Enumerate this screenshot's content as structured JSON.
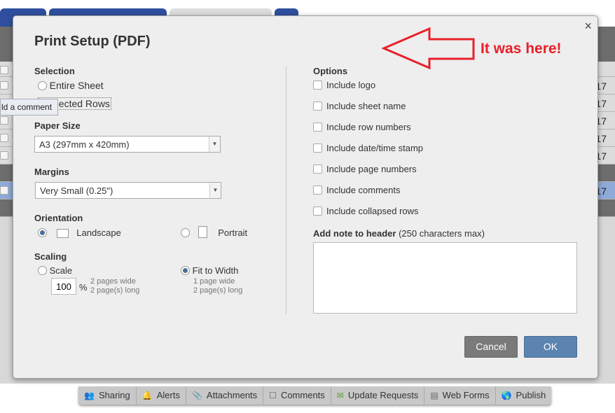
{
  "background": {
    "row_values": [
      "17",
      "17",
      "17",
      "17",
      "17",
      "17"
    ]
  },
  "tooltip": "ld a comment",
  "dialog": {
    "title": "Print Setup (PDF)",
    "close_icon": "×",
    "selection": {
      "label": "Selection",
      "entire_sheet": "Entire Sheet",
      "selected_rows": "elected Rows"
    },
    "paper_size": {
      "label": "Paper Size",
      "value": "A3 (297mm x 420mm)"
    },
    "margins": {
      "label": "Margins",
      "value": "Very Small (0.25\")"
    },
    "orientation": {
      "label": "Orientation",
      "landscape": "Landscape",
      "portrait": "Portrait",
      "selected": "Landscape"
    },
    "scaling": {
      "label": "Scaling",
      "scale": "Scale",
      "scale_value": "100",
      "percent": "%",
      "scale_info1": "2 pages wide",
      "scale_info2": "2 page(s) long",
      "fit": "Fit to Width",
      "fit_info1": "1 page wide",
      "fit_info2": "2 page(s) long",
      "selected": "Fit to Width"
    },
    "options": {
      "label": "Options",
      "items": [
        "Include logo",
        "Include sheet name",
        "Include row numbers",
        "Include date/time stamp",
        "Include page numbers",
        "Include comments",
        "Include collapsed rows"
      ]
    },
    "note": {
      "label": "Add note to header",
      "hint": "(250 characters max)",
      "value": ""
    },
    "cancel": "Cancel",
    "ok": "OK"
  },
  "annotation": {
    "text": "It was here!",
    "color": "#e8202a"
  },
  "bottom_bar": [
    {
      "label": "Sharing",
      "icon": "people-icon"
    },
    {
      "label": "Alerts",
      "icon": "bell-icon"
    },
    {
      "label": "Attachments",
      "icon": "paperclip-icon"
    },
    {
      "label": "Comments",
      "icon": "comment-icon"
    },
    {
      "label": "Update Requests",
      "icon": "update-request-icon"
    },
    {
      "label": "Web Forms",
      "icon": "form-icon"
    },
    {
      "label": "Publish",
      "icon": "globe-icon"
    }
  ],
  "colors": {
    "ok_button": "#5b84b1",
    "cancel_button": "#7a7a7a"
  }
}
